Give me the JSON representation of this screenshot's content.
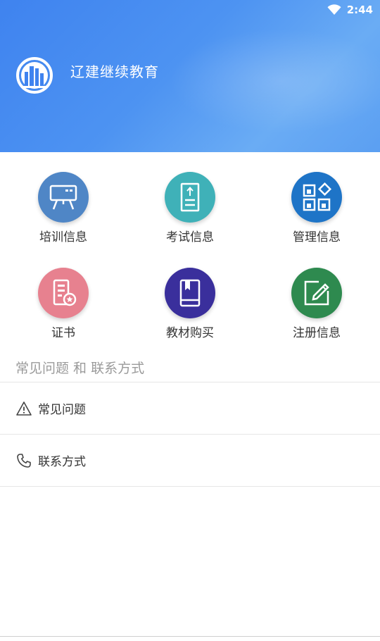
{
  "status_bar": {
    "time": "2:44",
    "wifi_icon": "wifi-icon"
  },
  "header": {
    "title": "辽建继续教育",
    "logo_icon": "city-buildings-logo"
  },
  "grid": {
    "items": [
      {
        "label": "培训信息",
        "icon": "presentation-board-icon",
        "color": "#4f86c6"
      },
      {
        "label": "考试信息",
        "icon": "upload-document-icon",
        "color": "#3fb1b8"
      },
      {
        "label": "管理信息",
        "icon": "apps-grid-icon",
        "color": "#1e74c7"
      },
      {
        "label": "证书",
        "icon": "certificate-icon",
        "color": "#e7818f"
      },
      {
        "label": "教材购买",
        "icon": "book-icon",
        "color": "#3a2f9c"
      },
      {
        "label": "注册信息",
        "icon": "edit-form-icon",
        "color": "#2e8a4f"
      }
    ]
  },
  "section": {
    "title": "常见问题 和 联系方式"
  },
  "list": {
    "items": [
      {
        "label": "常见问题",
        "icon": "warning-triangle-icon"
      },
      {
        "label": "联系方式",
        "icon": "phone-icon"
      }
    ]
  }
}
